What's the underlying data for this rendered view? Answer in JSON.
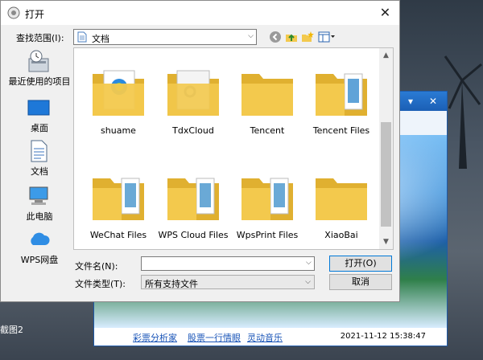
{
  "dialog": {
    "title": "打开",
    "close_glyph": "✕",
    "look_in_label": "查找范围(I):",
    "look_in_value": "文档",
    "file_name_label": "文件名(N):",
    "file_name_value": "",
    "file_type_label": "文件类型(T):",
    "file_type_value": "所有支持文件",
    "open_button": "打开(O)",
    "cancel_button": "取消"
  },
  "places": [
    {
      "label": "最近使用的项目",
      "icon": "recent-icon"
    },
    {
      "label": "桌面",
      "icon": "desktop-icon"
    },
    {
      "label": "文档",
      "icon": "documents-icon"
    },
    {
      "label": "此电脑",
      "icon": "computer-icon"
    },
    {
      "label": "WPS网盘",
      "icon": "cloud-icon"
    }
  ],
  "files": [
    {
      "name": "shuame"
    },
    {
      "name": "TdxCloud"
    },
    {
      "name": "Tencent"
    },
    {
      "name": "Tencent Files"
    },
    {
      "name": "WeChat Files"
    },
    {
      "name": "WPS Cloud Files"
    },
    {
      "name": "WpsPrint Files"
    },
    {
      "name": "XiaoBai"
    }
  ],
  "background_window": {
    "links": [
      "彩票分析家",
      "股票一行情眼",
      "灵动音乐"
    ],
    "timestamp": "2021-11-12 15:38:47",
    "titlebar_buttons": [
      "▾",
      "✕"
    ]
  },
  "desktop": {
    "left_edge_label": "截图2"
  },
  "colors": {
    "folder": "#f3c94d",
    "folder_dark": "#e0b030",
    "accent": "#0078d7"
  }
}
